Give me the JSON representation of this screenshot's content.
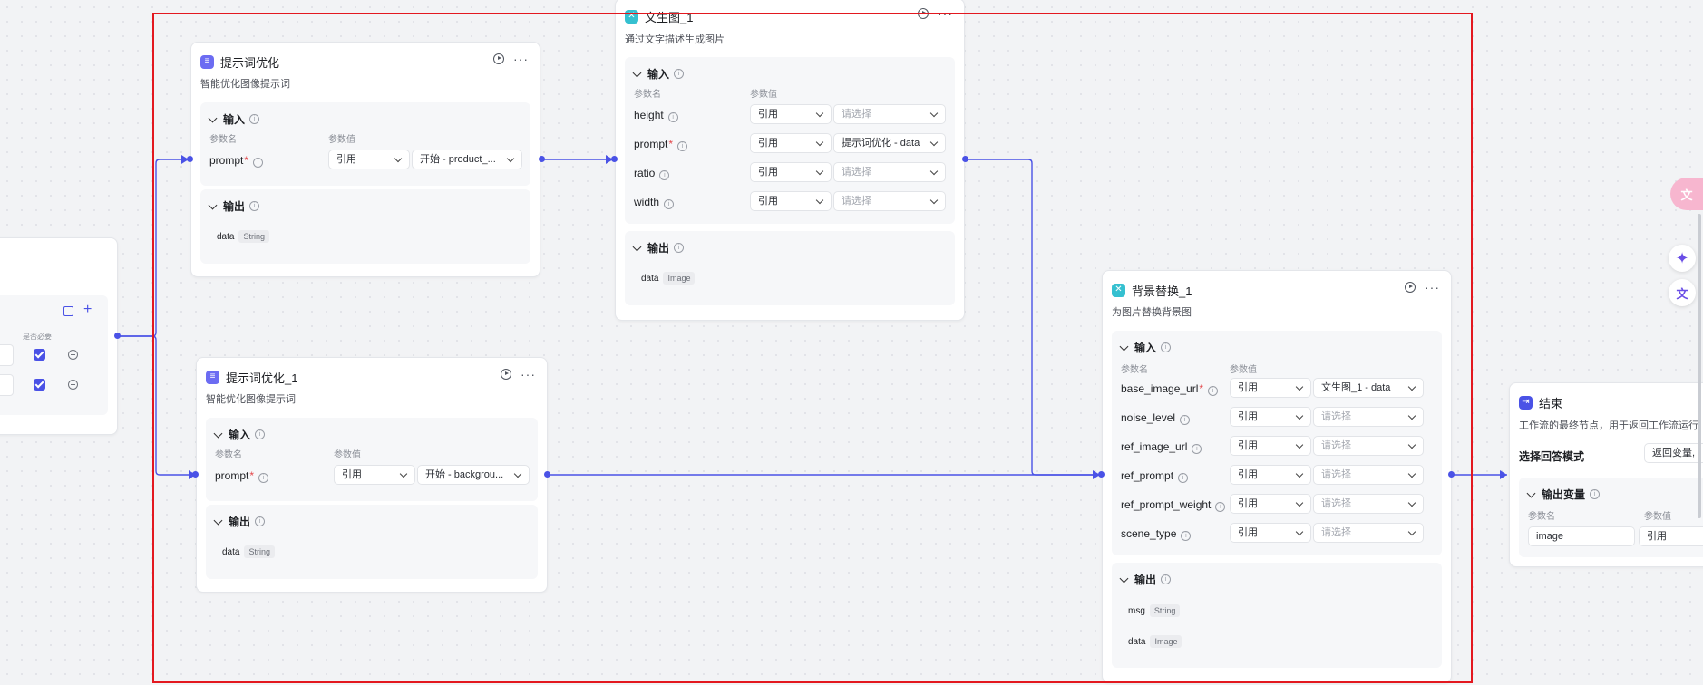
{
  "nodes": {
    "start_partial": {
      "col_header": "是否必要"
    },
    "prompt_opt": {
      "title": "提示词优化",
      "desc": "智能优化图像提示词",
      "input_label": "输入",
      "col_name": "参数名",
      "col_value": "参数值",
      "params": [
        {
          "name": "prompt",
          "mode": "引用",
          "value": "开始 - product_..."
        }
      ],
      "output_label": "输出",
      "outputs": [
        {
          "name": "data",
          "type": "String"
        }
      ]
    },
    "prompt_opt_1": {
      "title": "提示词优化_1",
      "desc": "智能优化图像提示词",
      "input_label": "输入",
      "col_name": "参数名",
      "col_value": "参数值",
      "params": [
        {
          "name": "prompt",
          "mode": "引用",
          "value": "开始 - backgrou..."
        }
      ],
      "output_label": "输出",
      "outputs": [
        {
          "name": "data",
          "type": "String"
        }
      ]
    },
    "text2img": {
      "title": "文生图_1",
      "desc": "通过文字描述生成图片",
      "input_label": "输入",
      "col_name": "参数名",
      "col_value": "参数值",
      "params": [
        {
          "name": "height",
          "mode": "引用",
          "value": "请选择",
          "placeholder": true
        },
        {
          "name": "prompt",
          "required": true,
          "mode": "引用",
          "value": "提示词优化 - data"
        },
        {
          "name": "ratio",
          "mode": "引用",
          "value": "请选择",
          "placeholder": true
        },
        {
          "name": "width",
          "mode": "引用",
          "value": "请选择",
          "placeholder": true
        }
      ],
      "output_label": "输出",
      "outputs": [
        {
          "name": "data",
          "type": "Image"
        }
      ]
    },
    "bg_replace": {
      "title": "背景替换_1",
      "desc": "为图片替换背景图",
      "input_label": "输入",
      "col_name": "参数名",
      "col_value": "参数值",
      "params": [
        {
          "name": "base_image_url",
          "required": true,
          "mode": "引用",
          "value": "文生图_1 - data"
        },
        {
          "name": "noise_level",
          "mode": "引用",
          "value": "请选择",
          "placeholder": true
        },
        {
          "name": "ref_image_url",
          "mode": "引用",
          "value": "请选择",
          "placeholder": true
        },
        {
          "name": "ref_prompt",
          "mode": "引用",
          "value": "请选择",
          "placeholder": true
        },
        {
          "name": "ref_prompt_weight",
          "mode": "引用",
          "value": "请选择",
          "placeholder": true
        },
        {
          "name": "scene_type",
          "mode": "引用",
          "value": "请选择",
          "placeholder": true
        }
      ],
      "output_label": "输出",
      "outputs": [
        {
          "name": "msg",
          "type": "String"
        },
        {
          "name": "data",
          "type": "Image"
        }
      ]
    },
    "end": {
      "title": "结束",
      "desc": "工作流的最终节点，用于返回工作流运行",
      "mode_label": "选择回答模式",
      "mode_value": "返回变量,",
      "output_label": "输出变量",
      "col_name": "参数名",
      "col_value": "参数值",
      "params": [
        {
          "name": "image",
          "mode": "引用"
        }
      ]
    }
  },
  "colors": {
    "accent": "#4a52e6",
    "selection": "#e3181f"
  },
  "side_icons": [
    "translate-pink-icon",
    "ai-sparkle-icon",
    "translate-icon"
  ]
}
